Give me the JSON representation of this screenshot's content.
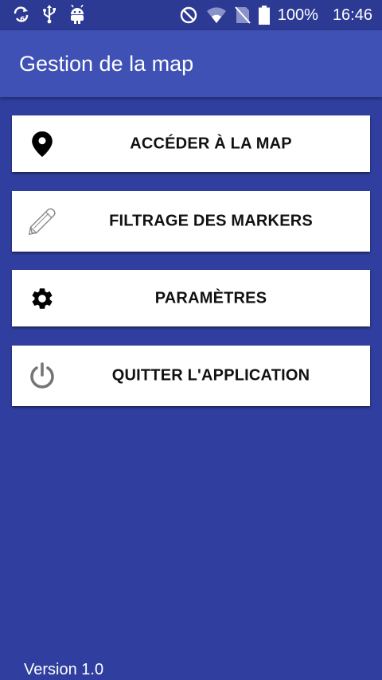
{
  "status_bar": {
    "battery": "100%",
    "time": "16:46",
    "icons": [
      "sync-icon",
      "usb-icon",
      "android-icon",
      "do-not-disturb-icon",
      "wifi-icon",
      "no-sim-icon",
      "battery-icon"
    ]
  },
  "app_bar": {
    "title": "Gestion de la map",
    "color": "#3f51b5"
  },
  "menu": {
    "items": [
      {
        "label": "ACCÉDER À LA MAP",
        "icon": "map-marker-icon"
      },
      {
        "label": "FILTRAGE DES MARKERS",
        "icon": "pencil-icon"
      },
      {
        "label": "PARAMÈTRES",
        "icon": "gear-icon"
      },
      {
        "label": "QUITTER L'APPLICATION",
        "icon": "power-icon"
      }
    ]
  },
  "footer": {
    "version": "Version 1.0"
  },
  "colors": {
    "background": "#303f9f",
    "status_bar": "#2c3a94",
    "button": "#ffffff"
  }
}
